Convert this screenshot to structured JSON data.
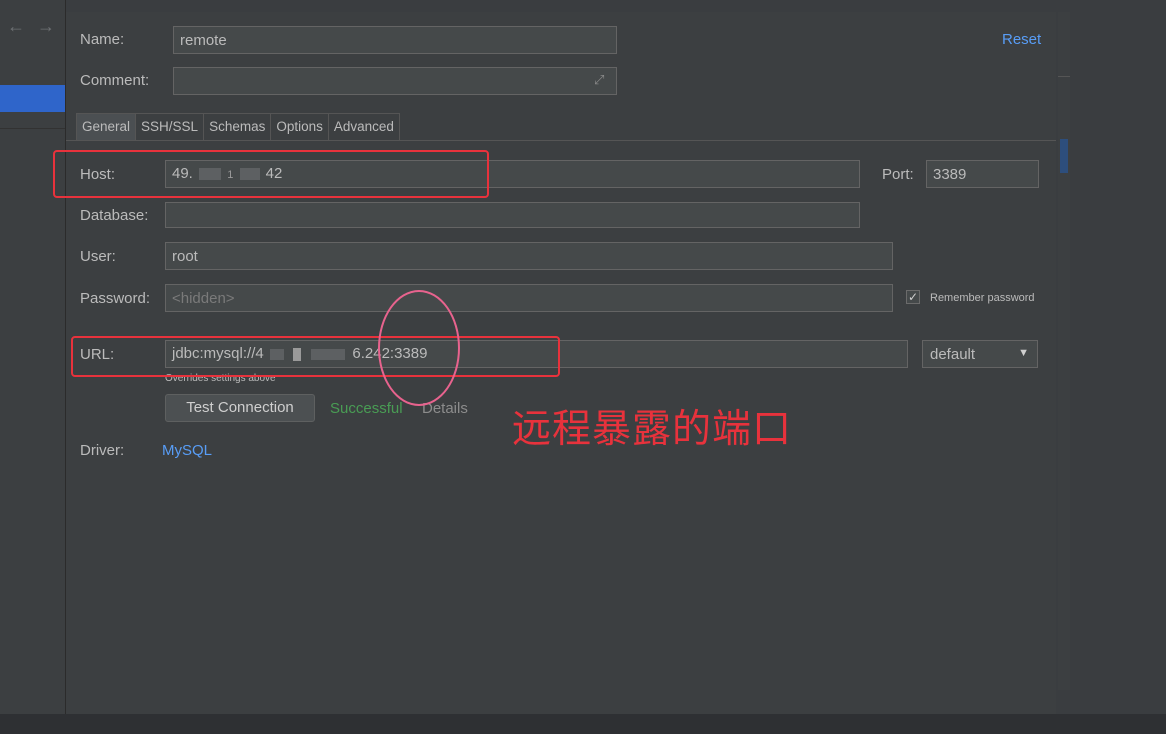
{
  "nav": {
    "back_glyph": "←",
    "forward_glyph": "→"
  },
  "form": {
    "name_label": "Name:",
    "name_value": "remote",
    "comment_label": "Comment:",
    "comment_value": "",
    "reset_label": "Reset",
    "tabs": [
      {
        "label": "General",
        "active": true
      },
      {
        "label": "SSH/SSL",
        "active": false
      },
      {
        "label": "Schemas",
        "active": false
      },
      {
        "label": "Options",
        "active": false
      },
      {
        "label": "Advanced",
        "active": false
      }
    ],
    "host_label": "Host:",
    "host_value_prefix": "49.",
    "host_value_mid": "1",
    "host_value_suffix": "42",
    "port_label": "Port:",
    "port_value": "3389",
    "database_label": "Database:",
    "database_value": "",
    "user_label": "User:",
    "user_value": "root",
    "password_label": "Password:",
    "password_placeholder": "<hidden>",
    "remember_password_label": "Remember password",
    "remember_password_checked": true,
    "url_label": "URL:",
    "url_value_prefix": "jdbc:mysql://4",
    "url_value_suffix": "6.242:3389",
    "url_mode": "default",
    "overrides_note": "Overrides settings above",
    "test_connection_label": "Test Connection",
    "test_status": "Successful",
    "details_label": "Details",
    "driver_label": "Driver:",
    "driver_value": "MySQL"
  },
  "annotation": {
    "text": "远程暴露的端口",
    "color": "#e8323c"
  },
  "colors": {
    "accent": "#589df6",
    "success": "#499c54",
    "selection": "#2f65ca",
    "annotation_box": "#e8323c",
    "annotation_ellipse": "#e8638e"
  },
  "icons": [
    "arrow-left-icon",
    "arrow-right-icon",
    "expand-icon",
    "check-icon",
    "chevron-down-icon"
  ]
}
